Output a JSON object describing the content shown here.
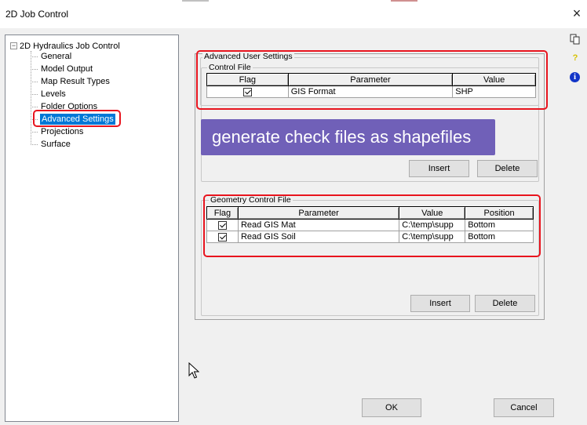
{
  "window": {
    "title": "2D Job Control",
    "close_glyph": "×"
  },
  "colors": {
    "accent": "#0078d7",
    "highlight_outline": "#e8141e",
    "callout_bg": "#7060b8",
    "info_icon": "#1235c8",
    "help_icon": "#d6c200"
  },
  "tree": {
    "expander": "−",
    "root": "2D Hydraulics Job Control",
    "items": [
      {
        "label": "General"
      },
      {
        "label": "Model Output"
      },
      {
        "label": "Map Result Types"
      },
      {
        "label": "Levels"
      },
      {
        "label": "Folder Options"
      },
      {
        "label": "Advanced Settings",
        "selected": true
      },
      {
        "label": "Projections"
      },
      {
        "label": "Surface"
      }
    ]
  },
  "advanced_user_settings": {
    "group_label": "Advanced User Settings",
    "control_file": {
      "group_label": "Control File",
      "columns": [
        "Flag",
        "Parameter",
        "Value"
      ],
      "rows": [
        {
          "flag_checked": true,
          "parameter": "GIS Format",
          "value": "SHP"
        }
      ],
      "insert_label": "Insert",
      "delete_label": "Delete"
    },
    "callout": "generate check files as shapefiles",
    "geometry_control_file": {
      "group_label": "Geometry Control File",
      "columns": [
        "Flag",
        "Parameter",
        "Value",
        "Position"
      ],
      "rows": [
        {
          "flag_checked": true,
          "parameter": "Read GIS Mat",
          "value": "C:\\temp\\supp",
          "position": "Bottom"
        },
        {
          "flag_checked": true,
          "parameter": "Read GIS Soil",
          "value": "C:\\temp\\supp",
          "position": "Bottom"
        }
      ],
      "insert_label": "Insert",
      "delete_label": "Delete"
    }
  },
  "footer": {
    "ok_label": "OK",
    "cancel_label": "Cancel"
  },
  "right_toolbar": [
    {
      "icon": "copy-icon"
    },
    {
      "icon": "help-icon",
      "glyph": "?"
    },
    {
      "icon": "info-icon",
      "glyph": "i"
    }
  ]
}
